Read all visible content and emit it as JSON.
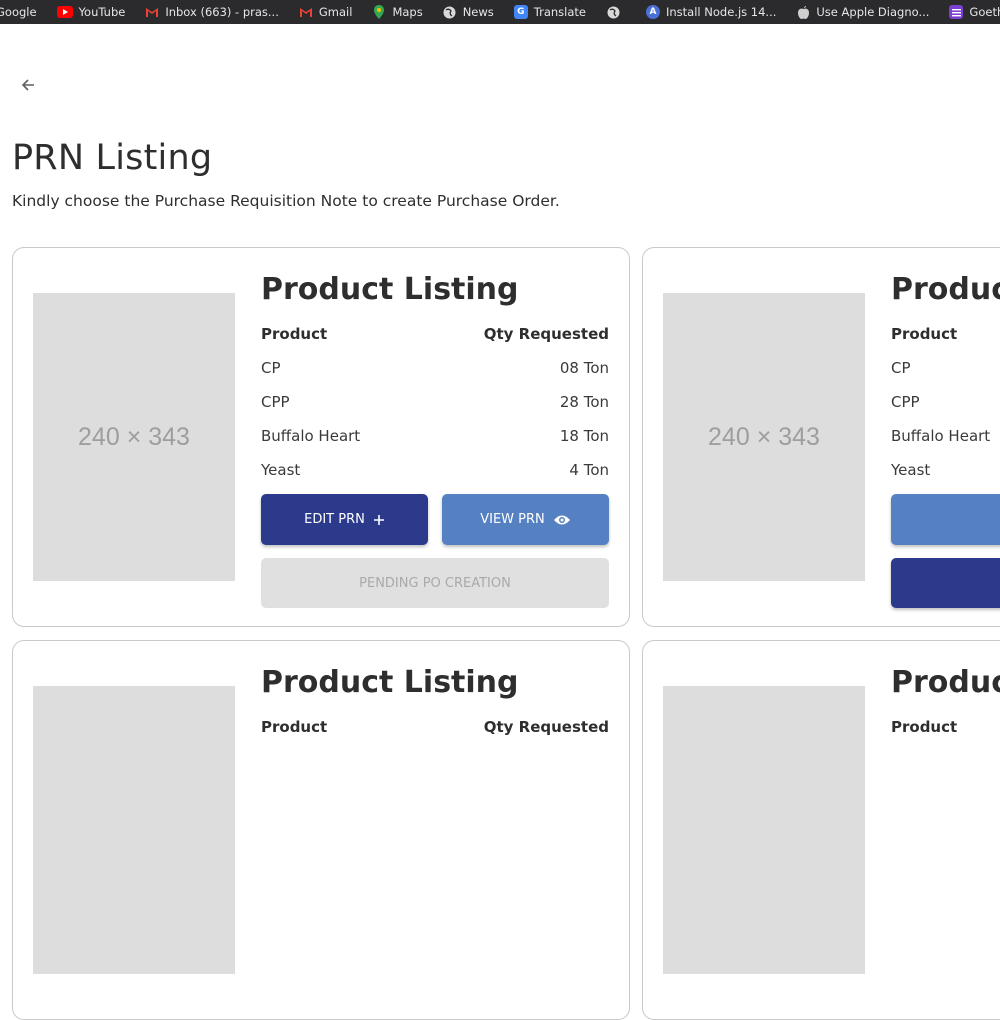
{
  "bookmarks": [
    {
      "label": "Google",
      "icon": "google-icon"
    },
    {
      "label": "YouTube",
      "icon": "youtube-icon",
      "color": "#ff0000"
    },
    {
      "label": "Inbox (663) - pras...",
      "icon": "gmail-icon"
    },
    {
      "label": "Gmail",
      "icon": "gmail-icon"
    },
    {
      "label": "Maps",
      "icon": "maps-icon"
    },
    {
      "label": "News",
      "icon": "globe-icon"
    },
    {
      "label": "Translate",
      "icon": "translate-icon"
    },
    {
      "label": "",
      "icon": "globe-icon"
    },
    {
      "label": "Install Node.js 14...",
      "icon": "node-icon"
    },
    {
      "label": "Use Apple Diagno...",
      "icon": "apple-icon"
    },
    {
      "label": "Goethe Zertifikat",
      "icon": "goethe-icon"
    }
  ],
  "page": {
    "title": "PRN Listing",
    "subtitle": "Kindly choose the Purchase Requisition Note to create Purchase Order."
  },
  "cards": [
    {
      "placeholder": "240 × 343",
      "title": "Product Listing",
      "col_product": "Product",
      "col_qty": "Qty Requested",
      "rows": [
        {
          "product": "CP",
          "qty": "08 Ton"
        },
        {
          "product": "CPP",
          "qty": "28 Ton"
        },
        {
          "product": "Buffalo Heart",
          "qty": "18 Ton"
        },
        {
          "product": "Yeast",
          "qty": "4 Ton"
        }
      ],
      "edit_label": "EDIT PRN",
      "view_label": "VIEW PRN",
      "status_label": "PENDING PO CREATION"
    },
    {
      "placeholder": "240 × 343",
      "title": "Product Listing",
      "col_product": "Product",
      "rows": [
        {
          "product": "CP"
        },
        {
          "product": "CPP"
        },
        {
          "product": "Buffalo Heart"
        },
        {
          "product": "Yeast"
        }
      ]
    },
    {
      "title": "Product Listing",
      "col_product": "Product",
      "col_qty": "Qty Requested"
    },
    {
      "title": "Product Listing",
      "col_product": "Product"
    }
  ],
  "colors": {
    "primary_dark": "#2c3a8c",
    "primary_light": "#5581c3",
    "disabled_bg": "#e0e0e0",
    "placeholder_bg": "#dddddd"
  }
}
